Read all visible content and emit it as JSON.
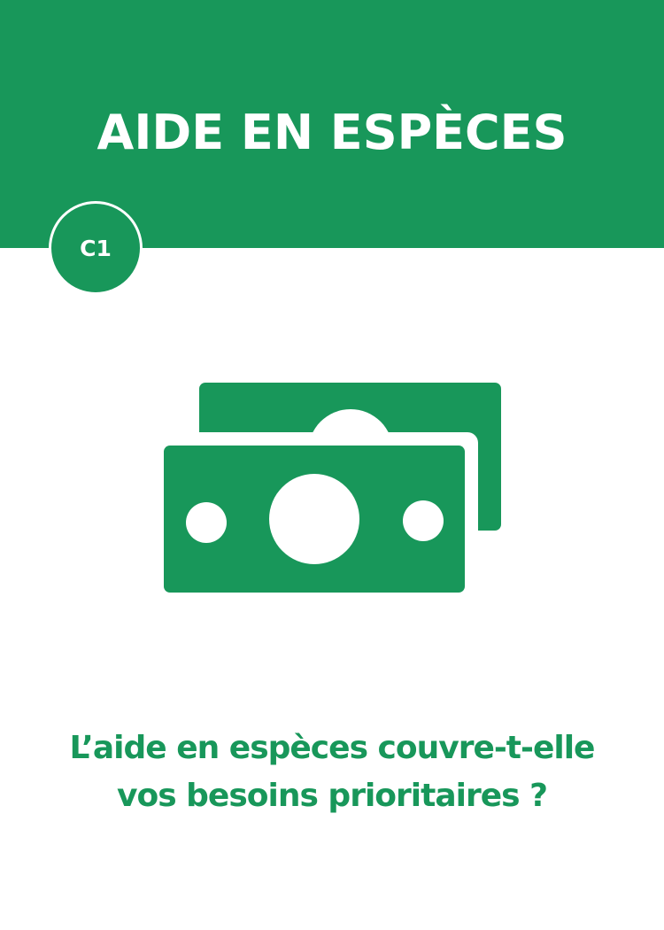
{
  "header": {
    "title": "AIDE EN ESPÈCES",
    "color": "#18975a"
  },
  "badge": {
    "label": "C1"
  },
  "illustration": {
    "icon": "banknotes-icon",
    "color": "#18975a"
  },
  "question": {
    "line1": "L’aide en espèces couvre-t-elle",
    "line2": "vos besoins prioritaires ?"
  }
}
